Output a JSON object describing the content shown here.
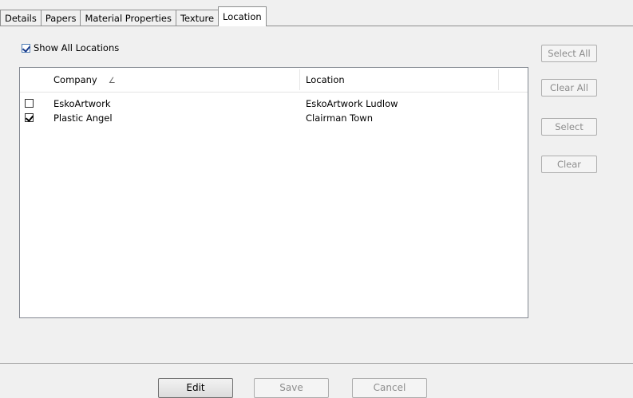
{
  "tabs": [
    "Details",
    "Papers",
    "Material Properties",
    "Texture",
    "Location"
  ],
  "active_tab": "Location",
  "show_all": {
    "label": "Show All Locations",
    "checked": true
  },
  "table": {
    "columns": [
      "Company",
      "Location"
    ],
    "sort_icon": "sort-ascending-icon",
    "rows": [
      {
        "checked": false,
        "company": "EskoArtwork",
        "location": "EskoArtwork Ludlow"
      },
      {
        "checked": true,
        "company": "Plastic Angel",
        "location": "Clairman Town"
      }
    ]
  },
  "side_buttons": [
    "Select All",
    "Clear All",
    "Select",
    "Clear"
  ],
  "bottom_buttons": {
    "edit": "Edit",
    "save": "Save",
    "cancel": "Cancel"
  }
}
